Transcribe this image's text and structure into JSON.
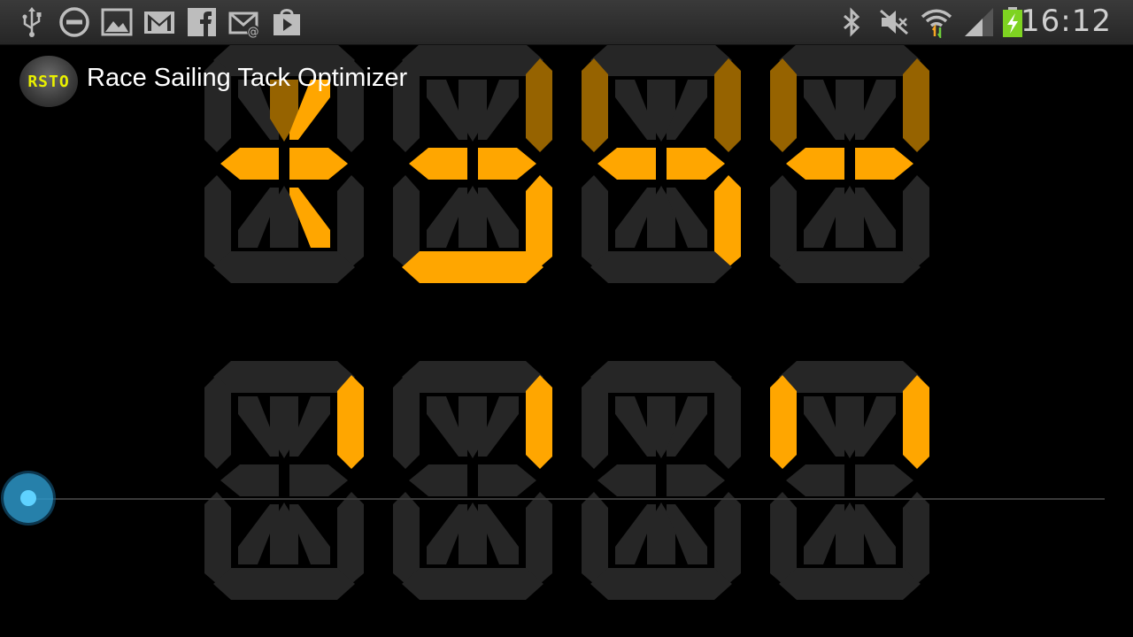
{
  "status_bar": {
    "time": "16:12",
    "left_icons": [
      "usb-icon",
      "do-not-disturb-icon",
      "gallery-icon",
      "gmail-icon",
      "facebook-icon",
      "email-icon",
      "play-store-icon"
    ],
    "right_icons": [
      "bluetooth-icon",
      "mute-icon",
      "wifi-icon",
      "signal-icon",
      "battery-charging-icon"
    ]
  },
  "action_bar": {
    "logo_text": "RSTO",
    "title": "Race Sailing Tack Optimizer"
  },
  "display": {
    "colors": {
      "on": "#ffa600",
      "dim": "#966300",
      "off": "#262626"
    },
    "row1": [
      {
        "on": [
          "g1",
          "g2",
          "j",
          "m"
        ],
        "dim": [
          "i"
        ]
      },
      {
        "on": [
          "g1",
          "g2",
          "c",
          "d"
        ],
        "dim": [
          "b"
        ]
      },
      {
        "on": [
          "g1",
          "g2",
          "c"
        ],
        "dim": [
          "f",
          "b"
        ]
      },
      {
        "on": [
          "g1",
          "g2"
        ],
        "dim": [
          "f",
          "b"
        ]
      }
    ],
    "row2": [
      {
        "on": [
          "b"
        ],
        "dim": []
      },
      {
        "on": [
          "b"
        ],
        "dim": []
      },
      {
        "on": [],
        "dim": []
      },
      {
        "on": [
          "f",
          "b"
        ],
        "dim": []
      }
    ]
  },
  "seekbar": {
    "progress": 0
  }
}
